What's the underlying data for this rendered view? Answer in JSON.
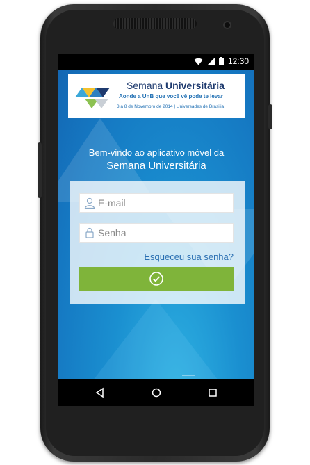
{
  "status_bar": {
    "time": "12:30"
  },
  "banner": {
    "brand_regular": "Semana ",
    "brand_bold": "Universitária",
    "tagline": "Aonde a UnB que você vê pode te levar",
    "dates": "3 a 8 de Novembro de 2014 | Universades de Brasilia"
  },
  "welcome": {
    "line1": "Bem-vindo ao aplicativo móvel da",
    "line2": "Semana Universitária"
  },
  "login": {
    "email_placeholder": "E-mail",
    "password_placeholder": "Senha",
    "forgot_label": "Esqueceu sua senha?"
  },
  "colors": {
    "submit": "#7fb43a",
    "link": "#2a6fb2",
    "background": "#1a8fd0"
  },
  "icons": {
    "back": "back-icon",
    "home": "home-icon",
    "recents": "recents-icon"
  }
}
